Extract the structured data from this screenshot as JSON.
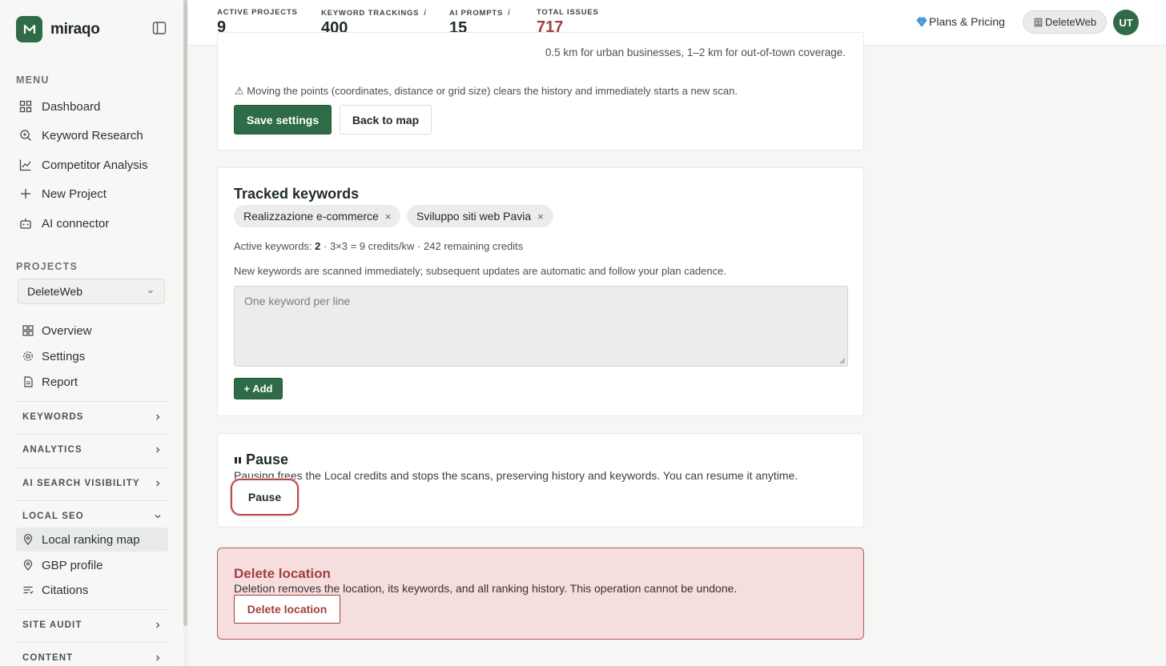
{
  "brand": {
    "name": "miraqo"
  },
  "sidebar": {
    "menu_label": "MENU",
    "menu": [
      {
        "label": "Dashboard",
        "icon": "dashboard-icon"
      },
      {
        "label": "Keyword Research",
        "icon": "search-icon"
      },
      {
        "label": "Competitor Analysis",
        "icon": "chart-line-icon"
      },
      {
        "label": "New Project",
        "icon": "plus-icon"
      },
      {
        "label": "AI connector",
        "icon": "robot-icon"
      }
    ],
    "projects_label": "PROJECTS",
    "project_selected": "DeleteWeb",
    "project_items": [
      {
        "label": "Overview"
      },
      {
        "label": "Settings"
      },
      {
        "label": "Report"
      }
    ],
    "groups": [
      {
        "label": "KEYWORDS"
      },
      {
        "label": "ANALYTICS"
      },
      {
        "label": "AI SEARCH VISIBILITY"
      },
      {
        "label": "LOCAL SEO"
      },
      {
        "label": "SITE AUDIT"
      },
      {
        "label": "CONTENT"
      }
    ],
    "local_seo_items": [
      {
        "label": "Local ranking map"
      },
      {
        "label": "GBP profile"
      },
      {
        "label": "Citations"
      }
    ]
  },
  "header": {
    "stats": [
      {
        "label": "ACTIVE PROJECTS",
        "value": "9",
        "info": ""
      },
      {
        "label": "KEYWORD TRACKINGS",
        "value": "400",
        "info": "i"
      },
      {
        "label": "AI PROMPTS",
        "value": "15",
        "info": "i"
      },
      {
        "label": "TOTAL ISSUES",
        "value": "717",
        "info": ""
      }
    ],
    "plans_label": "Plans & Pricing",
    "account_label": "DeleteWeb",
    "avatar_initials": "UT"
  },
  "settings_card": {
    "hint": "0.5 km for urban businesses, 1–2 km for out-of-town coverage.",
    "warning": "⚠ Moving the points (coordinates, distance or grid size) clears the history and immediately starts a new scan.",
    "save_label": "Save settings",
    "back_label": "Back to map"
  },
  "keywords_card": {
    "title": "Tracked keywords",
    "chips": [
      "Realizzazione e-commerce",
      "Sviluppo siti web Pavia"
    ],
    "active_prefix": "Active keywords: ",
    "active_count": "2",
    "active_suffix": " · 3×3 = 9 credits/kw · 242 remaining credits",
    "note": "New keywords are scanned immediately; subsequent updates are automatic and follow your plan cadence.",
    "textarea_placeholder": "One keyword per line",
    "add_label": "+ Add"
  },
  "pause_card": {
    "title": "Pause",
    "desc": "Pausing frees the Local credits and stops the scans, preserving history and keywords. You can resume it anytime.",
    "button_label": "Pause"
  },
  "delete_card": {
    "title": "Delete location",
    "desc": "Deletion removes the location, its keywords, and all ranking history. This operation cannot be undone.",
    "button_label": "Delete location"
  },
  "colors": {
    "brand": "#2e6b46",
    "danger": "#a23f3f",
    "danger_bg": "#f7dede"
  }
}
